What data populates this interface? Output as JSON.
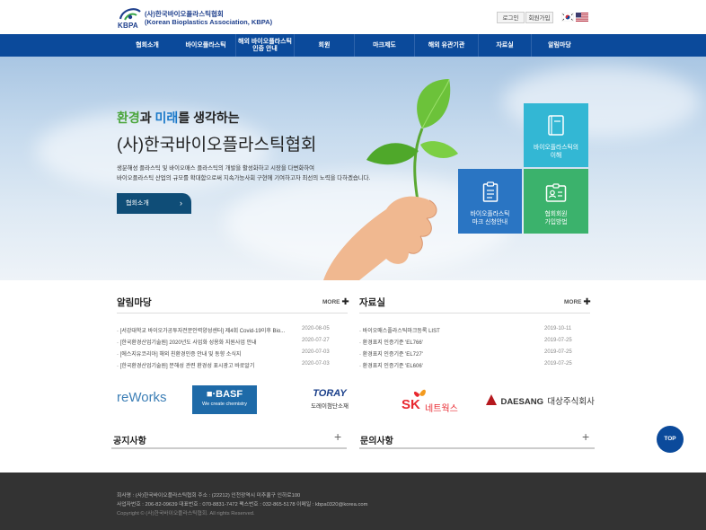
{
  "header": {
    "org_name_ko": "(사)한국바이오플라스틱협회",
    "org_name_en": "(Korean Bioplastics Association, KBPA)",
    "logo_abbr": "KBPA",
    "login": "로그인",
    "join": "회원가입"
  },
  "nav": [
    "협회소개",
    "바이오플라스틱",
    "해외 바이오플라스틱\n인증 안내",
    "회원",
    "마크제도",
    "해외 유관기관",
    "자료실",
    "알림마당"
  ],
  "hero": {
    "sub_part1": "환경",
    "sub_part2": "과 ",
    "sub_part3": "미래",
    "sub_part4": "를 생각하는",
    "title": "(사)한국바이오플라스틱협회",
    "desc1": "생분해성 플라스틱 및 바이오매스 플라스틱의 개발을 활성화하고 시장을 다변화하여",
    "desc2": "바이오플라스틱 산업의 규모를 확대함으로써 지속가능사회 구현에 기여하고자 최선의 노력을 다하겠습니다.",
    "button": "협회소개",
    "button_arrow": "›"
  },
  "tiles": [
    {
      "label1": "바이오플라스틱의",
      "label2": "이해",
      "icon": "book-icon"
    },
    {
      "label1": "바이오플라스틱",
      "label2": "마크 신청안내",
      "icon": "document-icon"
    },
    {
      "label1": "협회회원",
      "label2": "가입방법",
      "icon": "id-card-icon"
    }
  ],
  "notice": {
    "title": "알림마당",
    "more": "MORE",
    "plus": "✚",
    "items": [
      {
        "text": "[서강대학교 바이오가공투자전문인력양성센터] 제4회 Covid-19이후 Bio...",
        "date": "2020-08-05"
      },
      {
        "text": "[한국환경산업기술원] 2020년도 사업화 성용화 지원사업 안내",
        "date": "2020-07-27"
      },
      {
        "text": "[에스지유코리아] 해외 친환경인증 안내 및 동향 소식지",
        "date": "2020-07-03"
      },
      {
        "text": "[한국환경산업기술원] 분해성 관련 환경성 표시광고 바로알기",
        "date": "2020-07-03"
      }
    ]
  },
  "library": {
    "title": "자료실",
    "more": "MORE",
    "plus": "✚",
    "items": [
      {
        "text": "바이오매스플라스틱마크등록 LIST",
        "date": "2019-10-11"
      },
      {
        "text": "환경표지 인증기준 'EL766'",
        "date": "2019-07-25"
      },
      {
        "text": "환경표지 인증기준 'EL727'",
        "date": "2019-07-25"
      },
      {
        "text": "환경표지 인증기준 'EL606'",
        "date": "2019-07-25"
      }
    ]
  },
  "partners": {
    "nature": "reWorks",
    "basf_logo": "■·BASF",
    "basf_sub": "We create chemistry",
    "toray": "TORAY",
    "toray_sub": "도레이첨단소재",
    "sk": "SK",
    "sk_sub": "네트웍스",
    "daesang": "DAESANG",
    "daesang_ko": "대상주식회사"
  },
  "small_boards": {
    "notice": "공지사항",
    "qna": "문의사항",
    "plus": "+"
  },
  "top_button": "TOP",
  "footer": {
    "line1": "회사명 : (사)한국바이오플라스틱협회     주소 : (22212) 인천광역시 미추홀구 인하로100",
    "line2": "사업자번호 : 206-82-09639     대표번호 : 070-8831-7472     팩스번호 : 032-865-5178     이메일 : kbpa0320@korea.com",
    "copyright": "Copyright © (사)한국바이오플라스틱협회. All rights Reserved."
  },
  "colors": {
    "nav": "#0b4a9b",
    "tile1": "#33b7d4",
    "tile2": "#2a75c3",
    "tile3": "#3bb26c",
    "footer": "#333333",
    "accent_green": "#4aa53a",
    "accent_blue": "#1a79c9"
  }
}
